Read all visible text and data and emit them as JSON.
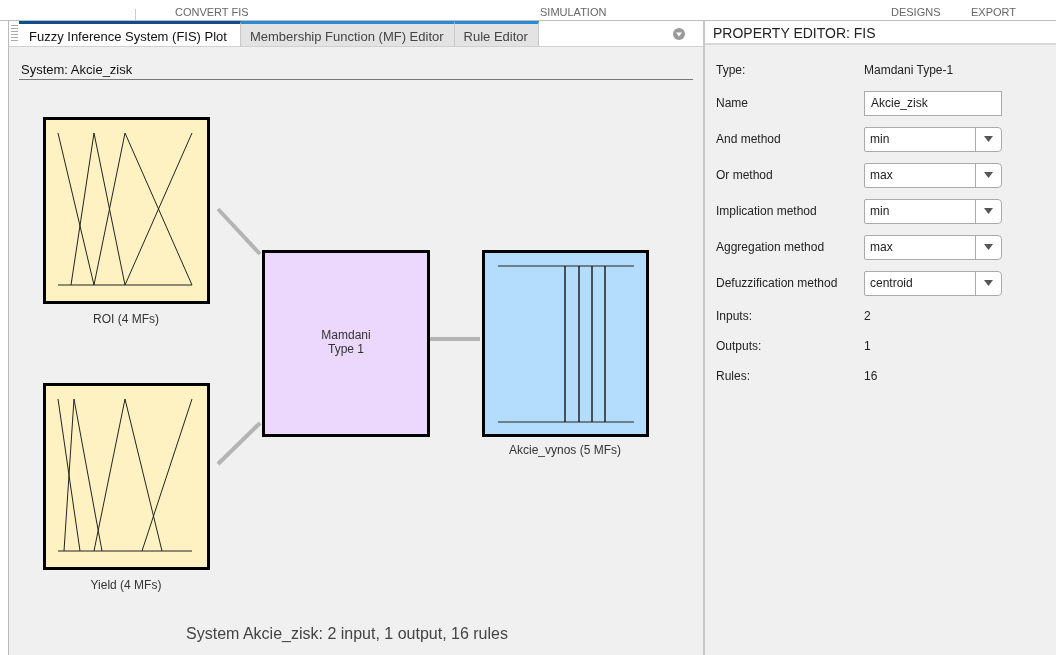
{
  "toolstrip": {
    "sections": [
      {
        "label": "CONVERT FIS"
      },
      {
        "label": "SIMULATION"
      },
      {
        "label": "DESIGNS"
      },
      {
        "label": "EXPORT"
      }
    ]
  },
  "tabs": [
    {
      "label": "Fuzzy Inference System (FIS) Plot",
      "selected": true
    },
    {
      "label": "Membership Function (MF) Editor",
      "selected": false
    },
    {
      "label": "Rule Editor",
      "selected": false
    }
  ],
  "system_label": "System: Akcie_zisk",
  "diagram": {
    "inputs": [
      {
        "label": "ROI (4 MFs)"
      },
      {
        "label": "Yield (4 MFs)"
      }
    ],
    "engine": {
      "lines": [
        "Mamdani",
        "Type 1"
      ]
    },
    "output": {
      "label": "Akcie_vynos (5 MFs)"
    },
    "summary": "System Akcie_zisk: 2 input, 1 output, 16 rules"
  },
  "property_editor": {
    "title": "PROPERTY EDITOR: FIS",
    "fields": [
      {
        "kind": "text",
        "label": "Type:",
        "value": "Mamdani Type-1"
      },
      {
        "kind": "input",
        "label": "Name",
        "value": "Akcie_zisk"
      },
      {
        "kind": "dropdown",
        "label": "And method",
        "value": "min"
      },
      {
        "kind": "dropdown",
        "label": "Or method",
        "value": "max"
      },
      {
        "kind": "dropdown",
        "label": "Implication method",
        "value": "min"
      },
      {
        "kind": "dropdown",
        "label": "Aggregation method",
        "value": "max"
      },
      {
        "kind": "dropdown",
        "label": "Defuzzification method",
        "value": "centroid"
      },
      {
        "kind": "text",
        "label": "Inputs:",
        "value": "2"
      },
      {
        "kind": "text",
        "label": "Outputs:",
        "value": "1"
      },
      {
        "kind": "text",
        "label": "Rules:",
        "value": "16"
      }
    ]
  }
}
